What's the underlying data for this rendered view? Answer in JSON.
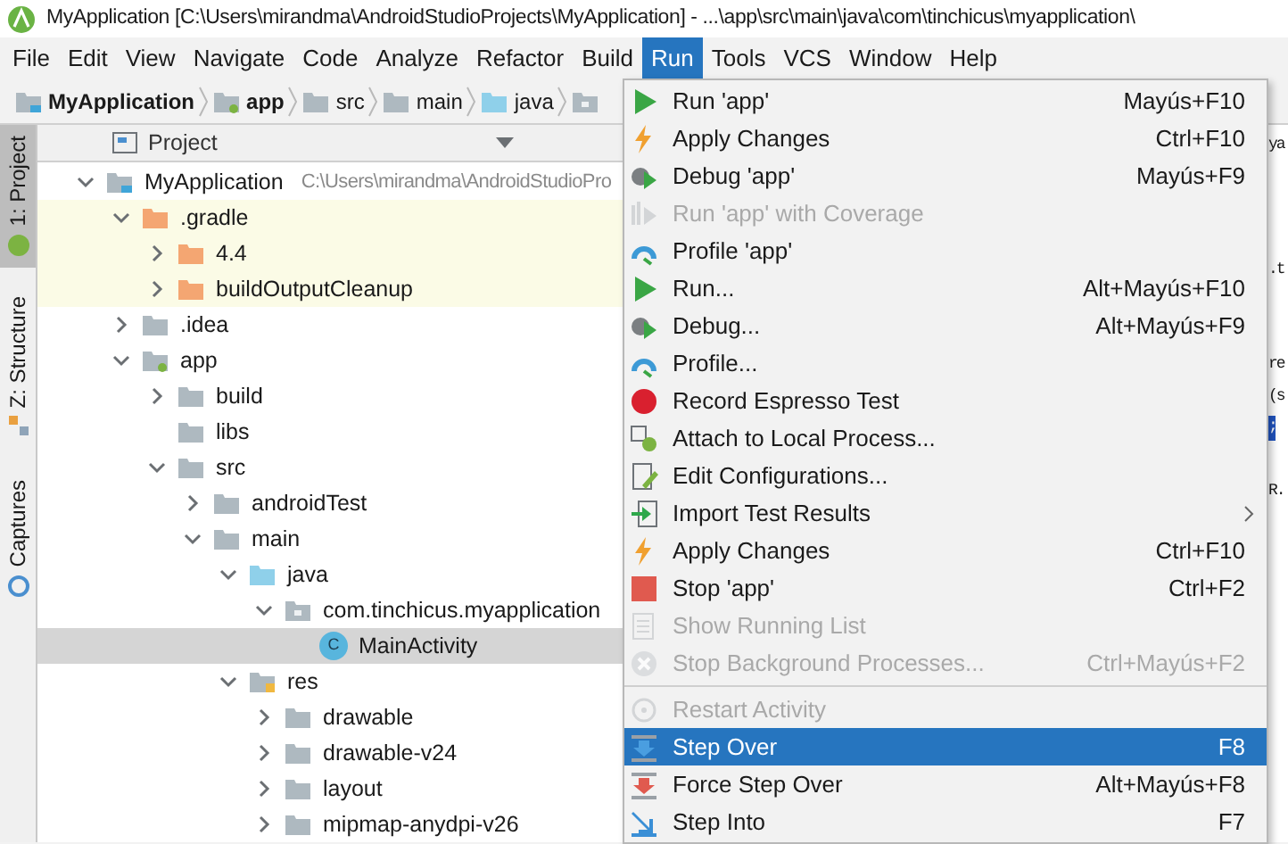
{
  "window": {
    "title": "MyApplication [C:\\Users\\mirandma\\AndroidStudioProjects\\MyApplication] - ...\\app\\src\\main\\java\\com\\tinchicus\\myapplication\\"
  },
  "menu_bar": [
    {
      "label": "File",
      "selected": false
    },
    {
      "label": "Edit",
      "selected": false
    },
    {
      "label": "View",
      "selected": false
    },
    {
      "label": "Navigate",
      "selected": false
    },
    {
      "label": "Code",
      "selected": false
    },
    {
      "label": "Analyze",
      "selected": false
    },
    {
      "label": "Refactor",
      "selected": false
    },
    {
      "label": "Build",
      "selected": false
    },
    {
      "label": "Run",
      "selected": true
    },
    {
      "label": "Tools",
      "selected": false
    },
    {
      "label": "VCS",
      "selected": false
    },
    {
      "label": "Window",
      "selected": false
    },
    {
      "label": "Help",
      "selected": false
    }
  ],
  "breadcrumb": [
    {
      "label": "MyApplication",
      "kind": "project",
      "bold": true
    },
    {
      "label": "app",
      "kind": "module",
      "bold": true
    },
    {
      "label": "src",
      "kind": "folder",
      "bold": false
    },
    {
      "label": "main",
      "kind": "folder",
      "bold": false
    },
    {
      "label": "java",
      "kind": "source",
      "bold": false
    },
    {
      "kind": "package"
    }
  ],
  "side_tabs": [
    {
      "label": "1: Project",
      "selected": true
    },
    {
      "label": "Z: Structure",
      "selected": false
    },
    {
      "label": "Captures",
      "selected": false
    }
  ],
  "project_panel": {
    "title": "Project",
    "tree": [
      {
        "label": "MyApplication",
        "path": "C:\\Users\\mirandma\\AndroidStudioPro",
        "kind": "project",
        "expanded": true,
        "highlighted": false,
        "selected": false,
        "children": [
          {
            "label": ".gradle",
            "kind": "excluded",
            "expanded": true,
            "highlighted": true,
            "selected": false,
            "children": [
              {
                "label": "4.4",
                "kind": "excluded",
                "expanded": false,
                "highlighted": true,
                "selected": false
              },
              {
                "label": "buildOutputCleanup",
                "kind": "excluded",
                "expanded": false,
                "highlighted": true,
                "selected": false
              }
            ]
          },
          {
            "label": ".idea",
            "kind": "folder",
            "expanded": false,
            "highlighted": false,
            "selected": false
          },
          {
            "label": "app",
            "kind": "module",
            "expanded": true,
            "highlighted": false,
            "selected": false,
            "children": [
              {
                "label": "build",
                "kind": "folder",
                "expanded": false,
                "highlighted": false,
                "selected": false
              },
              {
                "label": "libs",
                "kind": "folder",
                "highlighted": false,
                "selected": false
              },
              {
                "label": "src",
                "kind": "folder",
                "expanded": true,
                "highlighted": false,
                "selected": false,
                "children": [
                  {
                    "label": "androidTest",
                    "kind": "folder",
                    "expanded": false,
                    "highlighted": false,
                    "selected": false
                  },
                  {
                    "label": "main",
                    "kind": "folder",
                    "expanded": true,
                    "highlighted": false,
                    "selected": false,
                    "children": [
                      {
                        "label": "java",
                        "kind": "source",
                        "expanded": true,
                        "highlighted": false,
                        "selected": false,
                        "children": [
                          {
                            "label": "com.tinchicus.myapplication",
                            "kind": "package",
                            "expanded": true,
                            "highlighted": false,
                            "selected": false,
                            "children": [
                              {
                                "label": "MainActivity",
                                "kind": "class",
                                "badge": "C",
                                "highlighted": false,
                                "selected": true
                              }
                            ]
                          }
                        ]
                      },
                      {
                        "label": "res",
                        "kind": "resources",
                        "expanded": true,
                        "highlighted": false,
                        "selected": false,
                        "children": [
                          {
                            "label": "drawable",
                            "kind": "folder",
                            "expanded": false,
                            "highlighted": false,
                            "selected": false
                          },
                          {
                            "label": "drawable-v24",
                            "kind": "folder",
                            "expanded": false,
                            "highlighted": false,
                            "selected": false
                          },
                          {
                            "label": "layout",
                            "kind": "folder",
                            "expanded": false,
                            "highlighted": false,
                            "selected": false
                          },
                          {
                            "label": "mipmap-anydpi-v26",
                            "kind": "folder",
                            "expanded": false,
                            "highlighted": false,
                            "selected": false
                          }
                        ]
                      }
                    ]
                  }
                ]
              }
            ]
          }
        ]
      }
    ]
  },
  "editor_fragments": [
    {
      "text": "ya",
      "highlighted": false
    },
    {
      "text": ".t",
      "highlighted": false
    },
    {
      "text": "re",
      "highlighted": false
    },
    {
      "text": "(s",
      "highlighted": false
    },
    {
      "text": ";",
      "highlighted": true
    },
    {
      "text": "R.",
      "highlighted": false
    }
  ],
  "run_menu": [
    {
      "kind": "run",
      "label": "Run 'app'",
      "shortcut": "Mayús+F10",
      "disabled": false,
      "selected": false
    },
    {
      "kind": "bolt",
      "label": "Apply Changes",
      "shortcut": "Ctrl+F10",
      "disabled": false,
      "selected": false
    },
    {
      "kind": "debug",
      "label": "Debug 'app'",
      "shortcut": "Mayús+F9",
      "disabled": false,
      "selected": false
    },
    {
      "kind": "coverage",
      "label": "Run 'app' with Coverage",
      "disabled": true,
      "selected": false
    },
    {
      "kind": "profile",
      "label": "Profile 'app'",
      "disabled": false,
      "selected": false
    },
    {
      "kind": "run",
      "label": "Run...",
      "shortcut": "Alt+Mayús+F10",
      "disabled": false,
      "selected": false
    },
    {
      "kind": "debug",
      "label": "Debug...",
      "shortcut": "Alt+Mayús+F9",
      "disabled": false,
      "selected": false
    },
    {
      "kind": "profile",
      "label": "Profile...",
      "disabled": false,
      "selected": false
    },
    {
      "kind": "record",
      "label": "Record Espresso Test",
      "disabled": false,
      "selected": false
    },
    {
      "kind": "attach",
      "label": "Attach to Local Process...",
      "disabled": false,
      "selected": false
    },
    {
      "kind": "edit",
      "label": "Edit Configurations...",
      "disabled": false,
      "selected": false
    },
    {
      "kind": "import",
      "label": "Import Test Results",
      "submenu": true,
      "disabled": false,
      "selected": false
    },
    {
      "kind": "bolt",
      "label": "Apply Changes",
      "shortcut": "Ctrl+F10",
      "disabled": false,
      "selected": false
    },
    {
      "kind": "stop",
      "label": "Stop 'app'",
      "shortcut": "Ctrl+F2",
      "disabled": false,
      "selected": false
    },
    {
      "kind": "list",
      "label": "Show Running List",
      "disabled": true,
      "selected": false
    },
    {
      "kind": "cancel",
      "label": "Stop Background Processes...",
      "shortcut": "Ctrl+Mayús+F2",
      "disabled": true,
      "selected": false
    },
    {
      "kind": "separator"
    },
    {
      "kind": "restart",
      "label": "Restart Activity",
      "disabled": true,
      "selected": false
    },
    {
      "kind": "step_over",
      "label": "Step Over",
      "shortcut": "F8",
      "disabled": false,
      "selected": true
    },
    {
      "kind": "force_step",
      "label": "Force Step Over",
      "shortcut": "Alt+Mayús+F8",
      "disabled": false,
      "selected": false
    },
    {
      "kind": "step_into",
      "label": "Step Into",
      "shortcut": "F7",
      "disabled": false,
      "selected": false
    }
  ]
}
